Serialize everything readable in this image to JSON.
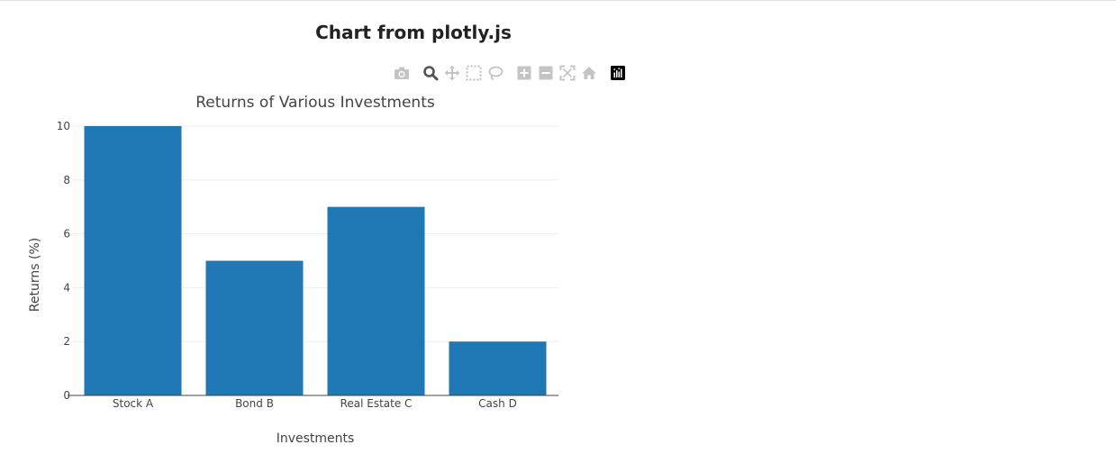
{
  "page": {
    "heading": "Chart from plotly.js"
  },
  "modebar": {
    "buttons": [
      {
        "icon": "camera-icon",
        "name": "download-plot-button"
      },
      {
        "icon": "zoom-icon",
        "name": "zoom-button"
      },
      {
        "icon": "pan-icon",
        "name": "pan-button"
      },
      {
        "icon": "box-select-icon",
        "name": "box-select-button"
      },
      {
        "icon": "lasso-select-icon",
        "name": "lasso-select-button"
      },
      {
        "icon": "zoom-in-icon",
        "name": "zoom-in-button"
      },
      {
        "icon": "zoom-out-icon",
        "name": "zoom-out-button"
      },
      {
        "icon": "autoscale-icon",
        "name": "autoscale-button"
      },
      {
        "icon": "home-icon",
        "name": "reset-axes-button"
      },
      {
        "icon": "plotly-logo-icon",
        "name": "plotly-logo-link"
      }
    ],
    "active": "zoom-icon",
    "icon_color": "#c4c4c4",
    "active_color": "#555555"
  },
  "chart_data": {
    "type": "bar",
    "title": "Returns of Various Investments",
    "xlabel": "Investments",
    "ylabel": "Returns (%)",
    "categories": [
      "Stock A",
      "Bond B",
      "Real Estate C",
      "Cash D"
    ],
    "values": [
      10,
      5,
      7,
      2
    ],
    "ylim": [
      0,
      10.5
    ],
    "yticks": [
      0,
      2,
      4,
      6,
      8,
      10
    ],
    "grid": true,
    "legend": "none",
    "bar_color": "#1f77b4",
    "grid_color": "#eeeeee"
  }
}
